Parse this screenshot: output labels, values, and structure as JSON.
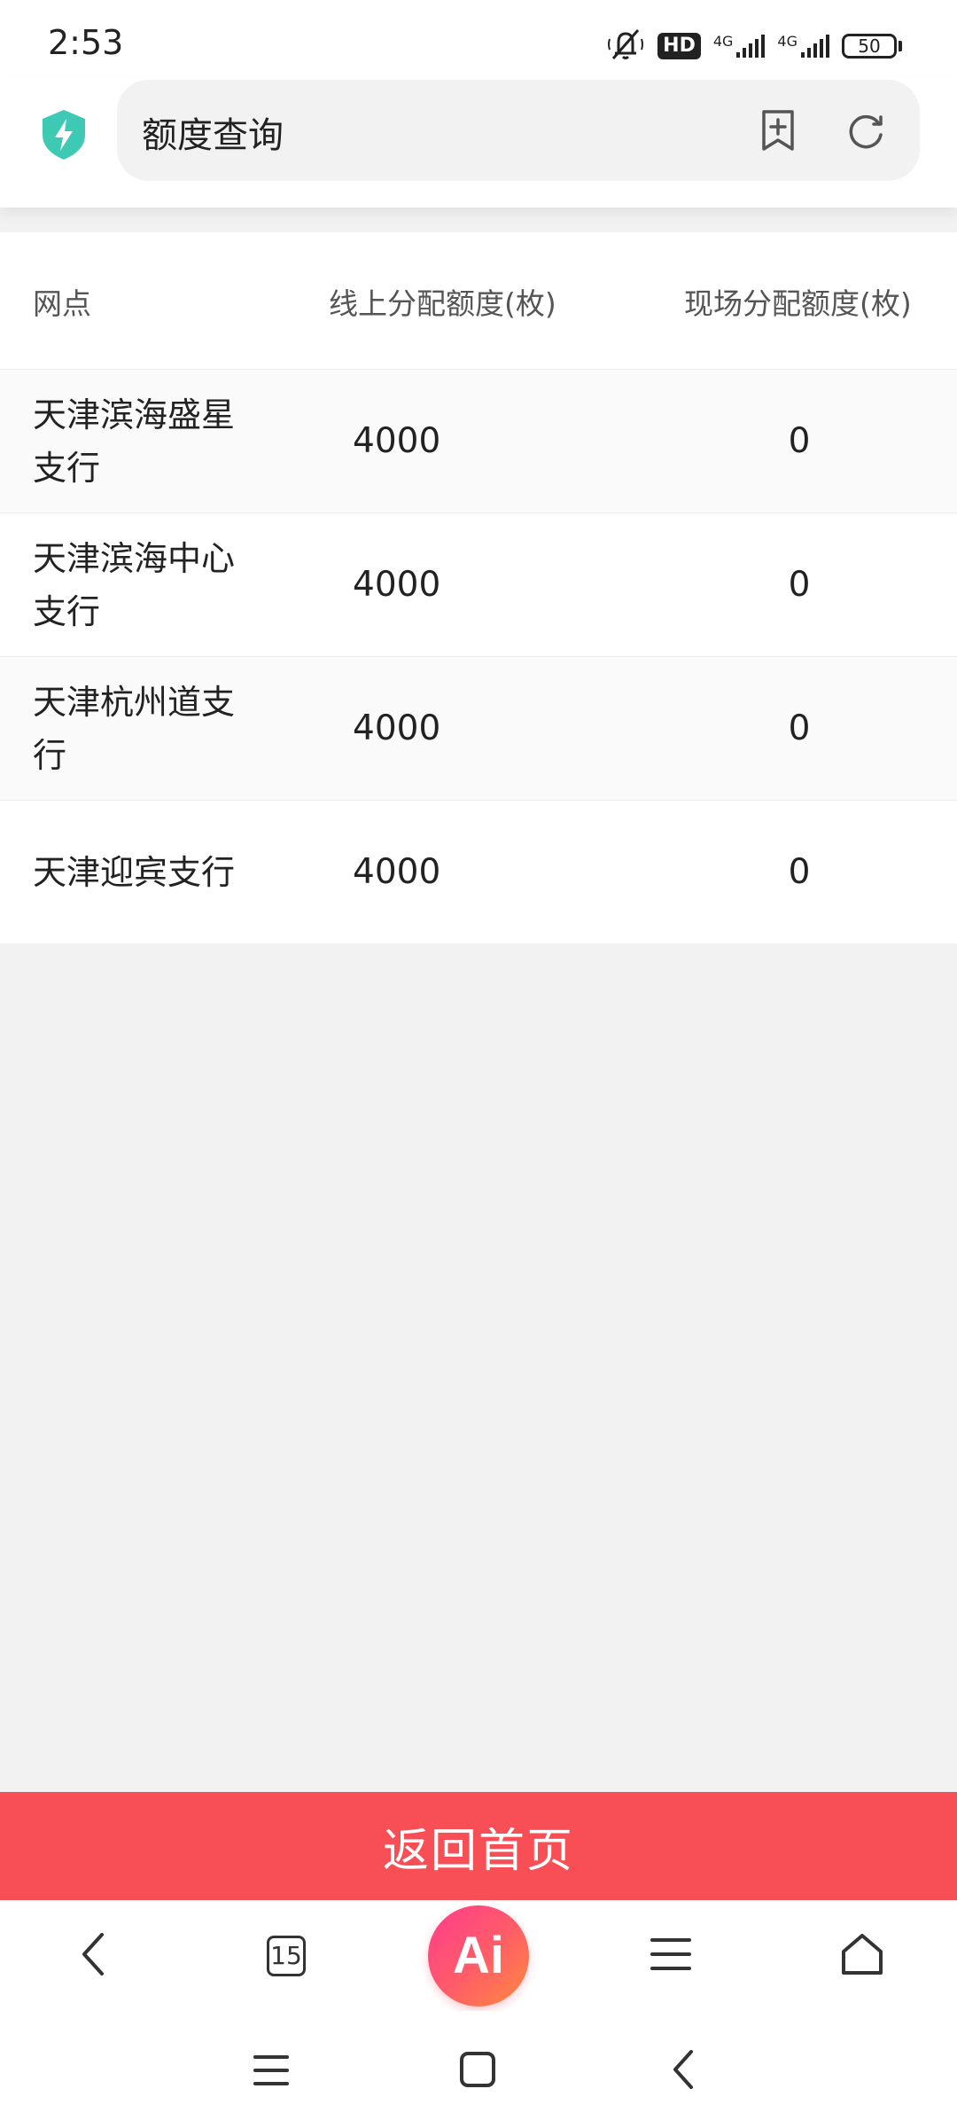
{
  "status_bar": {
    "time": "2:53",
    "hd_label": "HD",
    "network1": "4G",
    "network2": "4G",
    "battery": "50"
  },
  "browser": {
    "page_title": "额度查询",
    "tab_count": "15",
    "ai_label": "Ai"
  },
  "table": {
    "headers": [
      "网点",
      "线上分配额度(枚)",
      "现场分配额度(枚)"
    ],
    "rows": [
      {
        "name": "天津滨海盛星支行",
        "online": "4000",
        "onsite": "0"
      },
      {
        "name": "天津滨海中心支行",
        "online": "4000",
        "onsite": "0"
      },
      {
        "name": "天津杭州道支行",
        "online": "4000",
        "onsite": "0"
      },
      {
        "name": "天津迎宾支行",
        "online": "4000",
        "onsite": "0"
      }
    ]
  },
  "return_button_label": "返回首页",
  "colors": {
    "accent_red": "#f74f55",
    "shield_teal": "#3ec9b4"
  }
}
